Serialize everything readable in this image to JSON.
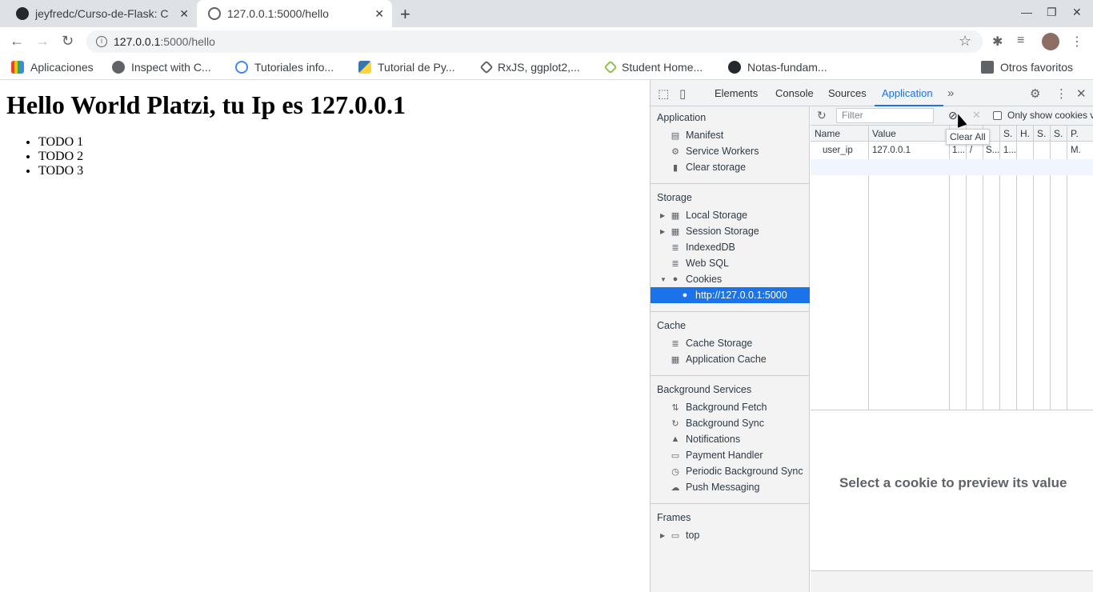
{
  "browser": {
    "tabs": [
      {
        "title": "jeyfredc/Curso-de-Flask: C",
        "close": "✕"
      },
      {
        "title": "127.0.0.1:5000/hello",
        "close": "✕"
      }
    ],
    "new_tab": "+",
    "window_controls": [
      "—",
      "❐",
      "✕"
    ],
    "nav": {
      "back": "←",
      "forward": "→",
      "reload": "↻"
    },
    "address": {
      "host": "127.0.0.1",
      "path": ":5000/hello",
      "info": "i"
    },
    "bookmark_star": "☆",
    "bookmarks": [
      {
        "label": "Aplicaciones"
      },
      {
        "label": "Inspect with C..."
      },
      {
        "label": "Tutoriales info..."
      },
      {
        "label": "Tutorial de Py..."
      },
      {
        "label": "RxJS, ggplot2,..."
      },
      {
        "label": "Student Home..."
      },
      {
        "label": "Notas-fundam..."
      },
      {
        "label": "Otros favoritos"
      }
    ]
  },
  "page": {
    "heading": "Hello World Platzi, tu Ip es 127.0.0.1",
    "todos": [
      "TODO 1",
      "TODO 2",
      "TODO 3"
    ]
  },
  "devtools": {
    "tabs": [
      "Elements",
      "Console",
      "Sources",
      "Application"
    ],
    "more": "»",
    "sidebar": {
      "application": {
        "title": "Application",
        "items": [
          "Manifest",
          "Service Workers",
          "Clear storage"
        ]
      },
      "storage": {
        "title": "Storage",
        "items": [
          "Local Storage",
          "Session Storage",
          "IndexedDB",
          "Web SQL",
          "Cookies",
          "http://127.0.0.1:5000"
        ]
      },
      "cache": {
        "title": "Cache",
        "items": [
          "Cache Storage",
          "Application Cache"
        ]
      },
      "background": {
        "title": "Background Services",
        "items": [
          "Background Fetch",
          "Background Sync",
          "Notifications",
          "Payment Handler",
          "Periodic Background Sync",
          "Push Messaging"
        ]
      },
      "frames": {
        "title": "Frames",
        "items": [
          "top"
        ]
      }
    },
    "cookies": {
      "filter_placeholder": "Filter",
      "only_show": "Only show cookies v",
      "tooltip": "Clear All",
      "columns": [
        "Name",
        "Value",
        "",
        "",
        "S.",
        "H.",
        "S.",
        "S.",
        "P."
      ],
      "row": {
        "name": "user_ip",
        "value": "127.0.0.1",
        "c3": "1...",
        "c4": "/",
        "c5": "S...",
        "c6": "1...",
        "p": "M."
      },
      "preview_text": "Select a cookie to preview its value"
    }
  }
}
